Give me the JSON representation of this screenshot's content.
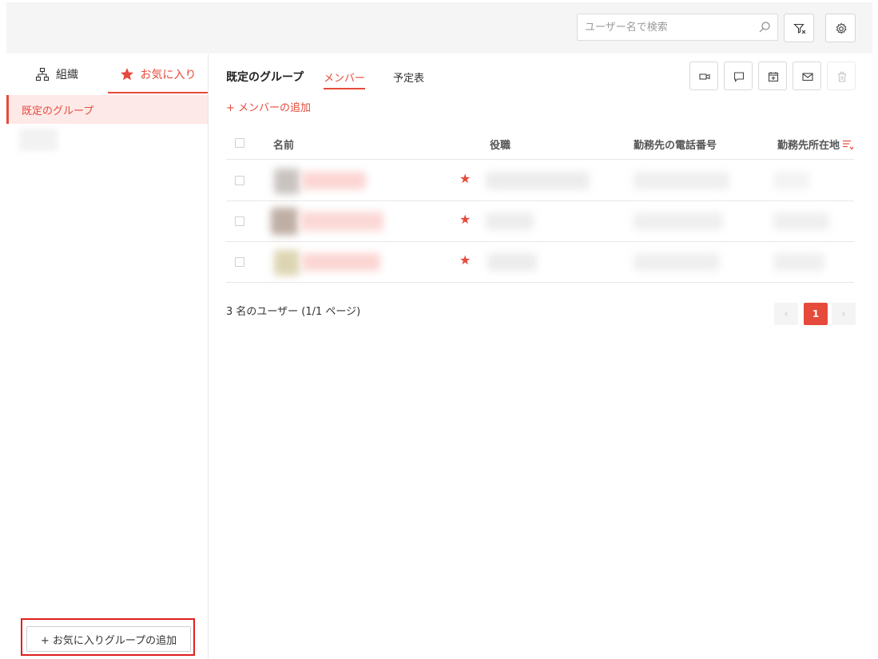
{
  "search": {
    "placeholder": "ユーザー名で検索"
  },
  "icons": {
    "search": "search-icon",
    "filter": "filter-icon",
    "settings": "gear-icon",
    "org": "org-chart-icon",
    "favorite": "star-icon",
    "video": "video-call-icon",
    "chat": "chat-icon",
    "calendar": "calendar-add-icon",
    "mail": "mail-icon",
    "delete": "trash-icon"
  },
  "colors": {
    "accent": "#e64a3b",
    "outline": "#e0201d"
  },
  "sidebar": {
    "tabs": [
      {
        "label": "組織"
      },
      {
        "label": "お気に入り"
      }
    ],
    "active_group": "既定のグループ",
    "add_favorite_group": "+ お気に入りグループの追加"
  },
  "main": {
    "group_title": "既定のグループ",
    "tabs": [
      {
        "label": "メンバー"
      },
      {
        "label": "予定表"
      }
    ],
    "add_member": "+ メンバーの追加",
    "columns": {
      "name": "名前",
      "role": "役職",
      "phone": "勤務先の電話番号",
      "location": "勤務先所在地"
    },
    "row_star": "★",
    "footer": "3 名のユーザー (1/1 ページ)",
    "pagination": {
      "prev": "‹",
      "current": "1",
      "next": "›"
    }
  }
}
